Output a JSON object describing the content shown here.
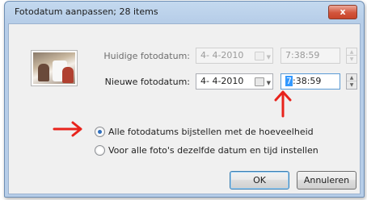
{
  "window": {
    "title": "Fotodatum aanpassen; 28 items",
    "close_label": "x"
  },
  "current": {
    "label": "Huidige fotodatum:",
    "date": "4- 4-2010",
    "time": "7:38:59"
  },
  "new": {
    "label": "Nieuwe fotodatum:",
    "date": "4- 4-2010",
    "time_selected": "7",
    "time_rest": ":38:59"
  },
  "options": {
    "adjust_all": "Alle fotodatums bijstellen met de hoeveelheid",
    "same_for_all": "Voor alle foto's dezelfde datum en tijd instellen",
    "selected": "adjust_all"
  },
  "buttons": {
    "ok": "OK",
    "cancel": "Annuleren"
  },
  "colors": {
    "annotation_red": "#e8231c",
    "title_bar": "#b6cde8",
    "selection": "#3399ff"
  }
}
